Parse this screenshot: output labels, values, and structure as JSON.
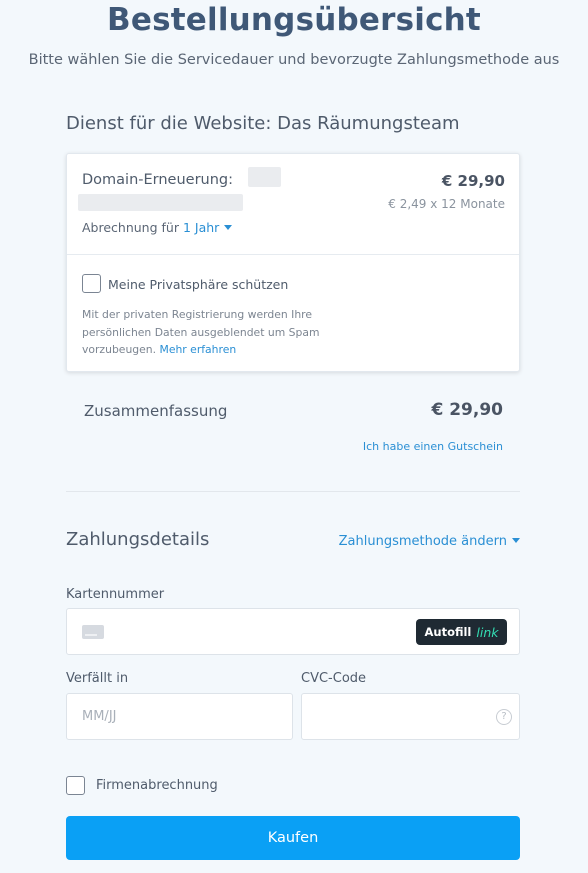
{
  "page": {
    "title": "Bestellungsübersicht",
    "subtitle": "Bitte wählen Sie die Servicedauer und bevorzugte Zahlungsmethode aus"
  },
  "service": {
    "heading": "Dienst für die Website: Das Räumungsteam",
    "product": {
      "label": "Domain-Erneuerung:",
      "price": "€ 29,90",
      "monthly": "€ 2,49 x 12 Monate",
      "billing_prefix": "Abrechnung für",
      "billing_period": "1 Jahr"
    },
    "privacy": {
      "label": "Meine Privatsphäre schützen",
      "description": "Mit der privaten Registrierung werden Ihre persönlichen Daten ausgeblendet um Spam vorzubeugen.",
      "link": "Mehr erfahren",
      "checked": false
    }
  },
  "summary": {
    "label": "Zusammenfassung",
    "total": "€ 29,90",
    "voucher_link": "Ich habe einen Gutschein"
  },
  "payment": {
    "heading": "Zahlungsdetails",
    "change_method": "Zahlungsmethode ändern",
    "card_number_label": "Kartennummer",
    "autofill_label": "Autofill",
    "autofill_brand": "link",
    "expiry_label": "Verfällt in",
    "expiry_placeholder": "MM/JJ",
    "cvc_label": "CVC-Code",
    "cvc_help": "?",
    "company_billing_label": "Firmenabrechnung",
    "company_billing_checked": false,
    "buy_label": "Kaufen"
  },
  "icons": {
    "card": "credit-card-icon",
    "dropdown": "caret-down-icon",
    "help": "question-circle-icon"
  },
  "colors": {
    "accent": "#2a8fd4",
    "button": "#0aa0f5",
    "title": "#3f5877",
    "background": "#f3f8fc",
    "autofill_bg": "#1f2a33",
    "autofill_brand": "#33ddb3"
  }
}
